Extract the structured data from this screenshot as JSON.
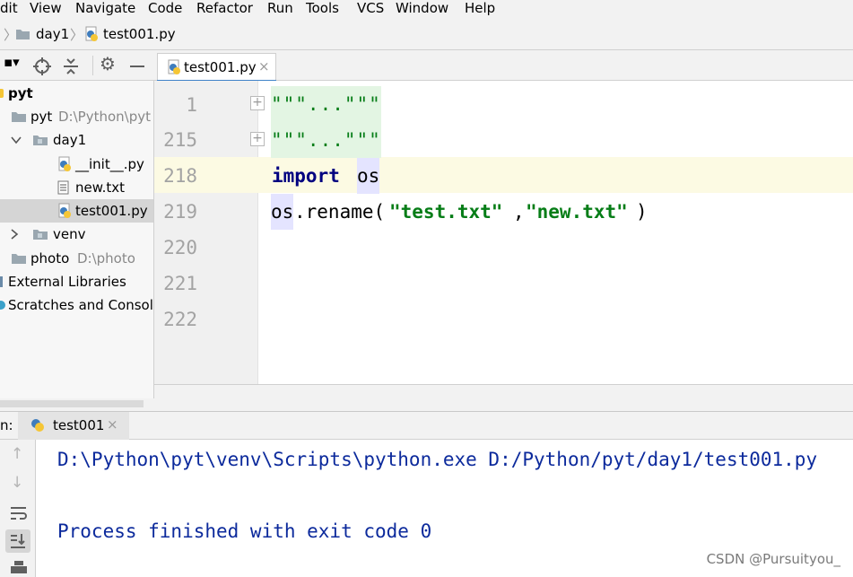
{
  "menu": [
    "dit",
    "View",
    "Navigate",
    "Code",
    "Refactor",
    "Run",
    "Tools",
    "VCS",
    "Window",
    "Help"
  ],
  "breadcrumb": {
    "folder": "day1",
    "file": "test001.py"
  },
  "project_tree": {
    "root": "pyt",
    "items": [
      {
        "label": "pyt",
        "hint": "D:\\Python\\pyt"
      },
      {
        "label": "day1"
      },
      {
        "label": "__init__.py"
      },
      {
        "label": "new.txt"
      },
      {
        "label": "test001.py",
        "selected": true
      },
      {
        "label": "venv"
      },
      {
        "label": "photo",
        "hint": "D:\\photo"
      },
      {
        "label": "External Libraries"
      },
      {
        "label": "Scratches and Consoles"
      }
    ]
  },
  "editor": {
    "tab_label": "test001.py",
    "tab_close": "×",
    "line_numbers": [
      "1",
      "215",
      "218",
      "219",
      "220",
      "221",
      "222"
    ],
    "folded_1": "\"\"\"...\"\"\"",
    "folded_215": "\"\"\"...\"\"\"",
    "kw_import": "import",
    "mod_os": "os",
    "call_obj": "os",
    "call_method": ".rename(",
    "arg1": "\"test.txt\"",
    "comma": ",",
    "arg2": "\"new.txt\"",
    "close_paren": ")"
  },
  "run": {
    "label_prefix": "n:",
    "tab_label": "test001",
    "tab_close": "×",
    "console_lines": [
      "D:\\Python\\pyt\\venv\\Scripts\\python.exe D:/Python/pyt/day1/test001.py",
      "Process finished with exit code 0"
    ]
  },
  "watermark": "CSDN @Pursuityou_",
  "colors": {
    "keyword": "#000080",
    "string": "#067d17",
    "console_text": "#0c2a9c",
    "fold_bg": "#e3f5e3",
    "caret_line": "#fcfae3",
    "tab_accent": "#4083c9"
  }
}
